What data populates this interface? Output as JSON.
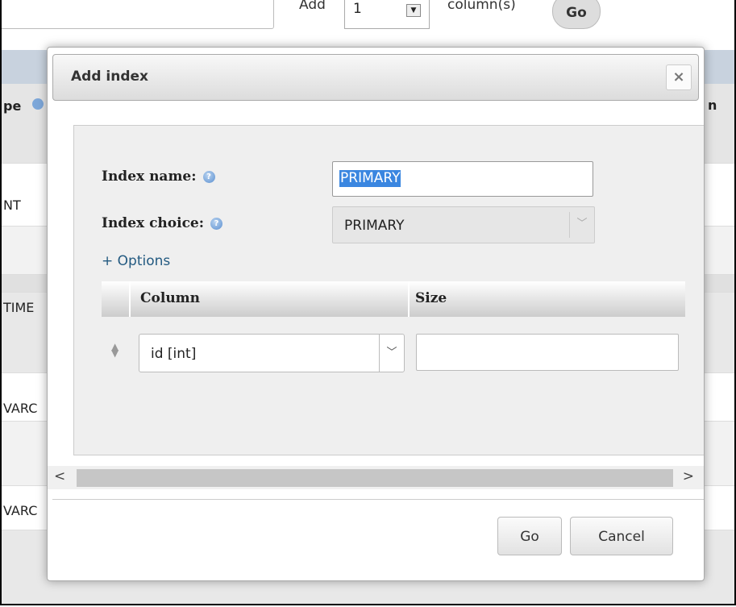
{
  "background": {
    "add_label": "Add",
    "add_count": "1",
    "columns_label": "column(s)",
    "go_label": "Go",
    "header_left": "pe",
    "header_right": "n",
    "rows": [
      "NT",
      "TIME",
      "VARC",
      "VARC"
    ]
  },
  "dialog": {
    "title": "Add index",
    "close_symbol": "×",
    "index_name_label": "Index name:",
    "index_name_value": "PRIMARY",
    "index_choice_label": "Index choice:",
    "index_choice_value": "PRIMARY",
    "options_link": "+ Options",
    "table": {
      "headers": [
        "Column",
        "Size"
      ],
      "rows": [
        {
          "column": "id [int]",
          "size": ""
        }
      ]
    },
    "buttons": {
      "go": "Go",
      "cancel": "Cancel"
    }
  }
}
